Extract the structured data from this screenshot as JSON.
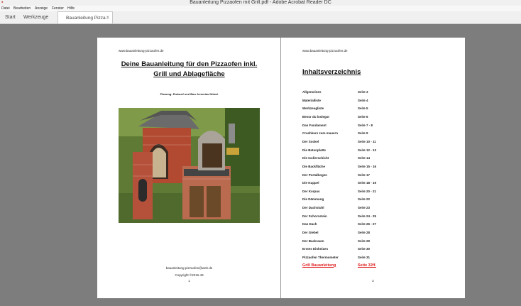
{
  "window": {
    "title": "Bauanleitung Pizzaofen mit Grill.pdf - Adobe Acrobat Reader DC",
    "icon": "acrobat-icon"
  },
  "menu": [
    "Datei",
    "Bearbeiten",
    "Anzeige",
    "Fenster",
    "Hilfe"
  ],
  "tabs": {
    "start": "Start",
    "tools": "Werkzeuge",
    "document": "Bauanleitung Pizza...",
    "close": "×"
  },
  "left_page": {
    "url": "www.bauanleitung-pizzaofen.de",
    "title_line1": "Deine Bauanleitung für den Pizzaofen inkl.",
    "title_line2": "Grill und Ablagefläche",
    "subtitle": "Planung: Entwurf und Bau Jeremias Nützel",
    "email": "bauanleitung-pizzaofen@web.de",
    "copyright": "Copyright ©2016-49",
    "page_number": "1"
  },
  "right_page": {
    "url": "www.bauanleitung-pizzaofen.de",
    "toc_title": "Inhaltsverzeichnis",
    "toc": [
      {
        "name": "Allgemeines",
        "page": "Seite 3"
      },
      {
        "name": "Materialliste",
        "page": "Seite 4"
      },
      {
        "name": "Werkzeugliste",
        "page": "Seite 5"
      },
      {
        "name": "Bevor du loslegst",
        "page": "Seite 6"
      },
      {
        "name": "Das Fundament",
        "page": "Seite 7 - 8"
      },
      {
        "name": "Crashkurs zum mauern",
        "page": "Seite 9"
      },
      {
        "name": "Der Sockel",
        "page": "Seite 10 - 11"
      },
      {
        "name": "Die Betonplatte",
        "page": "Seite 12 - 13"
      },
      {
        "name": "Die Isolierschicht",
        "page": "Seite 14"
      },
      {
        "name": "Die Backfläche",
        "page": "Seite 15 - 16"
      },
      {
        "name": "Der Portalbogen",
        "page": "Seite 17"
      },
      {
        "name": "Die Kuppel",
        "page": "Seite 18 - 19"
      },
      {
        "name": "Der Korpus",
        "page": "Seite 20 - 21"
      },
      {
        "name": "Die Dämmung",
        "page": "Seite 22"
      },
      {
        "name": "Der Dachstuhl",
        "page": "Seite 23"
      },
      {
        "name": "Der Schornstein",
        "page": "Seite 24 - 25"
      },
      {
        "name": "Das Dach",
        "page": "Seite 26 - 27"
      },
      {
        "name": "Der Giebel",
        "page": "Seite 28"
      },
      {
        "name": "Der Backraum",
        "page": "Seite 29"
      },
      {
        "name": "Erstes Einheizen",
        "page": "Seite 30"
      },
      {
        "name": "Pizzaofen Thermometer",
        "page": "Seite 31"
      },
      {
        "name": "Grill Bauanleitung",
        "page": "Seite 32ff."
      }
    ],
    "page_number": "2"
  },
  "colors": {
    "highlight": "#e02020",
    "viewer_background": "#7d7d7d"
  }
}
